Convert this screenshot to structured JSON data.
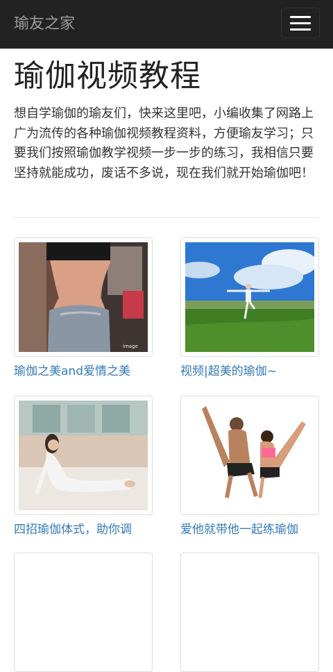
{
  "navbar": {
    "brand": "瑜友之家",
    "menu_icon": "hamburger-menu-icon"
  },
  "main": {
    "title": "瑜伽视频教程",
    "intro": "想自学瑜伽的瑜友们，快来这里吧，小编收集了网路上广为流传的各种瑜伽视频教程资料，方便瑜友学习；只要我们按照瑜伽教学视频一步一步的练习，我相信只要坚持就能成功，废话不多说，现在我们就开始瑜伽吧！"
  },
  "articles": [
    {
      "title": "瑜伽之美and爱情之美"
    },
    {
      "title": "视频|超美的瑜伽~"
    },
    {
      "title": "四招瑜伽体式，助你调"
    },
    {
      "title": "爱他就带他一起练瑜伽"
    }
  ],
  "colors": {
    "navbar_bg": "#222222",
    "brand_text": "#9d9d9d",
    "link": "#337ab7"
  }
}
